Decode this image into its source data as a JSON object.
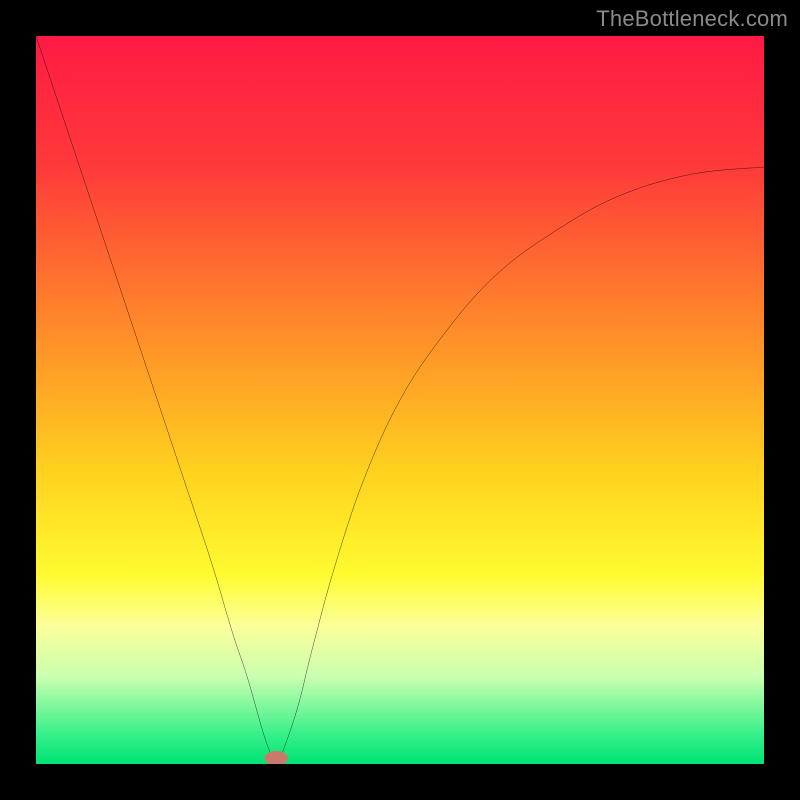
{
  "watermark": {
    "text": "TheBottleneck.com"
  },
  "chart_data": {
    "type": "line",
    "title": "",
    "xlabel": "",
    "ylabel": "",
    "xlim": [
      0,
      100
    ],
    "ylim": [
      0,
      100
    ],
    "grid": false,
    "legend": false,
    "background_gradient": {
      "direction": "vertical",
      "stops": [
        {
          "pct": 0,
          "color": "#ff1a44"
        },
        {
          "pct": 18,
          "color": "#ff3a3a"
        },
        {
          "pct": 40,
          "color": "#ff8a2a"
        },
        {
          "pct": 60,
          "color": "#ffd21e"
        },
        {
          "pct": 74,
          "color": "#fffb30"
        },
        {
          "pct": 81,
          "color": "#fbff99"
        },
        {
          "pct": 88,
          "color": "#caffb0"
        },
        {
          "pct": 96,
          "color": "#35f089"
        },
        {
          "pct": 100,
          "color": "#00e374"
        }
      ]
    },
    "series": [
      {
        "name": "bottleneck-curve",
        "color": "#000000",
        "stroke_width": 2.6,
        "x": [
          0,
          4,
          8,
          12,
          16,
          20,
          24,
          27,
          29,
          31,
          32,
          33,
          34,
          36,
          38,
          41,
          45,
          50,
          56,
          63,
          71,
          80,
          90,
          100
        ],
        "y": [
          100,
          88,
          76,
          64,
          52,
          40,
          28,
          18,
          12,
          5,
          2,
          0,
          2,
          8,
          16,
          27,
          39,
          50,
          59,
          67,
          73,
          78,
          81,
          82
        ]
      }
    ],
    "marker": {
      "name": "min-point",
      "x": 33,
      "y": 0.8,
      "color": "#c97b6b",
      "rx": 1.6,
      "ry": 1.0
    }
  }
}
